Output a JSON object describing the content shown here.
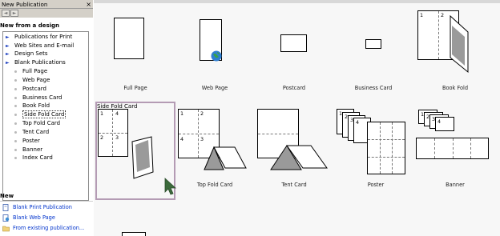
{
  "pane": {
    "title": "New Publication",
    "close_glyph": "×",
    "back_glyph": "◄",
    "fwd_glyph": "►",
    "new_from_design": "New from a design",
    "tree": [
      {
        "type": "branch",
        "label": "Publications for Print"
      },
      {
        "type": "branch",
        "label": "Web Sites and E-mail"
      },
      {
        "type": "branch",
        "label": "Design Sets"
      },
      {
        "type": "branch",
        "label": "Blank Publications"
      },
      {
        "type": "leaf",
        "label": "Full Page"
      },
      {
        "type": "leaf",
        "label": "Web Page"
      },
      {
        "type": "leaf",
        "label": "Postcard"
      },
      {
        "type": "leaf",
        "label": "Business Card"
      },
      {
        "type": "leaf",
        "label": "Book Fold"
      },
      {
        "type": "leaf",
        "label": "Side Fold Card",
        "selected": true
      },
      {
        "type": "leaf",
        "label": "Top Fold Card"
      },
      {
        "type": "leaf",
        "label": "Tent Card"
      },
      {
        "type": "leaf",
        "label": "Poster"
      },
      {
        "type": "leaf",
        "label": "Banner"
      },
      {
        "type": "leaf",
        "label": "Index Card"
      }
    ],
    "new_heading": "New",
    "new_links": [
      {
        "label": "Blank Print Publication",
        "icon": "blank-print-icon"
      },
      {
        "label": "Blank Web Page",
        "icon": "blank-web-icon"
      },
      {
        "label": "From existing publication...",
        "icon": "existing-publication-icon"
      }
    ]
  },
  "gallery": {
    "tiles": [
      {
        "caption": "Full Page"
      },
      {
        "caption": "Web Page"
      },
      {
        "caption": "Postcard"
      },
      {
        "caption": "Business Card"
      },
      {
        "caption": "Book Fold"
      },
      {
        "caption": "Side Fold Card"
      },
      {
        "caption": "Top Fold Card"
      },
      {
        "caption": "Tent Card"
      },
      {
        "caption": "Poster"
      },
      {
        "caption": "Banner"
      }
    ],
    "page_numbers": {
      "one": "1",
      "two": "2",
      "three": "3",
      "four": "4"
    },
    "selected": "Side Fold Card"
  },
  "colors": {
    "link_blue": "#0033cc",
    "arrow_blue": "#1a3cbf",
    "selection_border": "#b49bb4",
    "pane_bar": "#d4d0c8"
  }
}
